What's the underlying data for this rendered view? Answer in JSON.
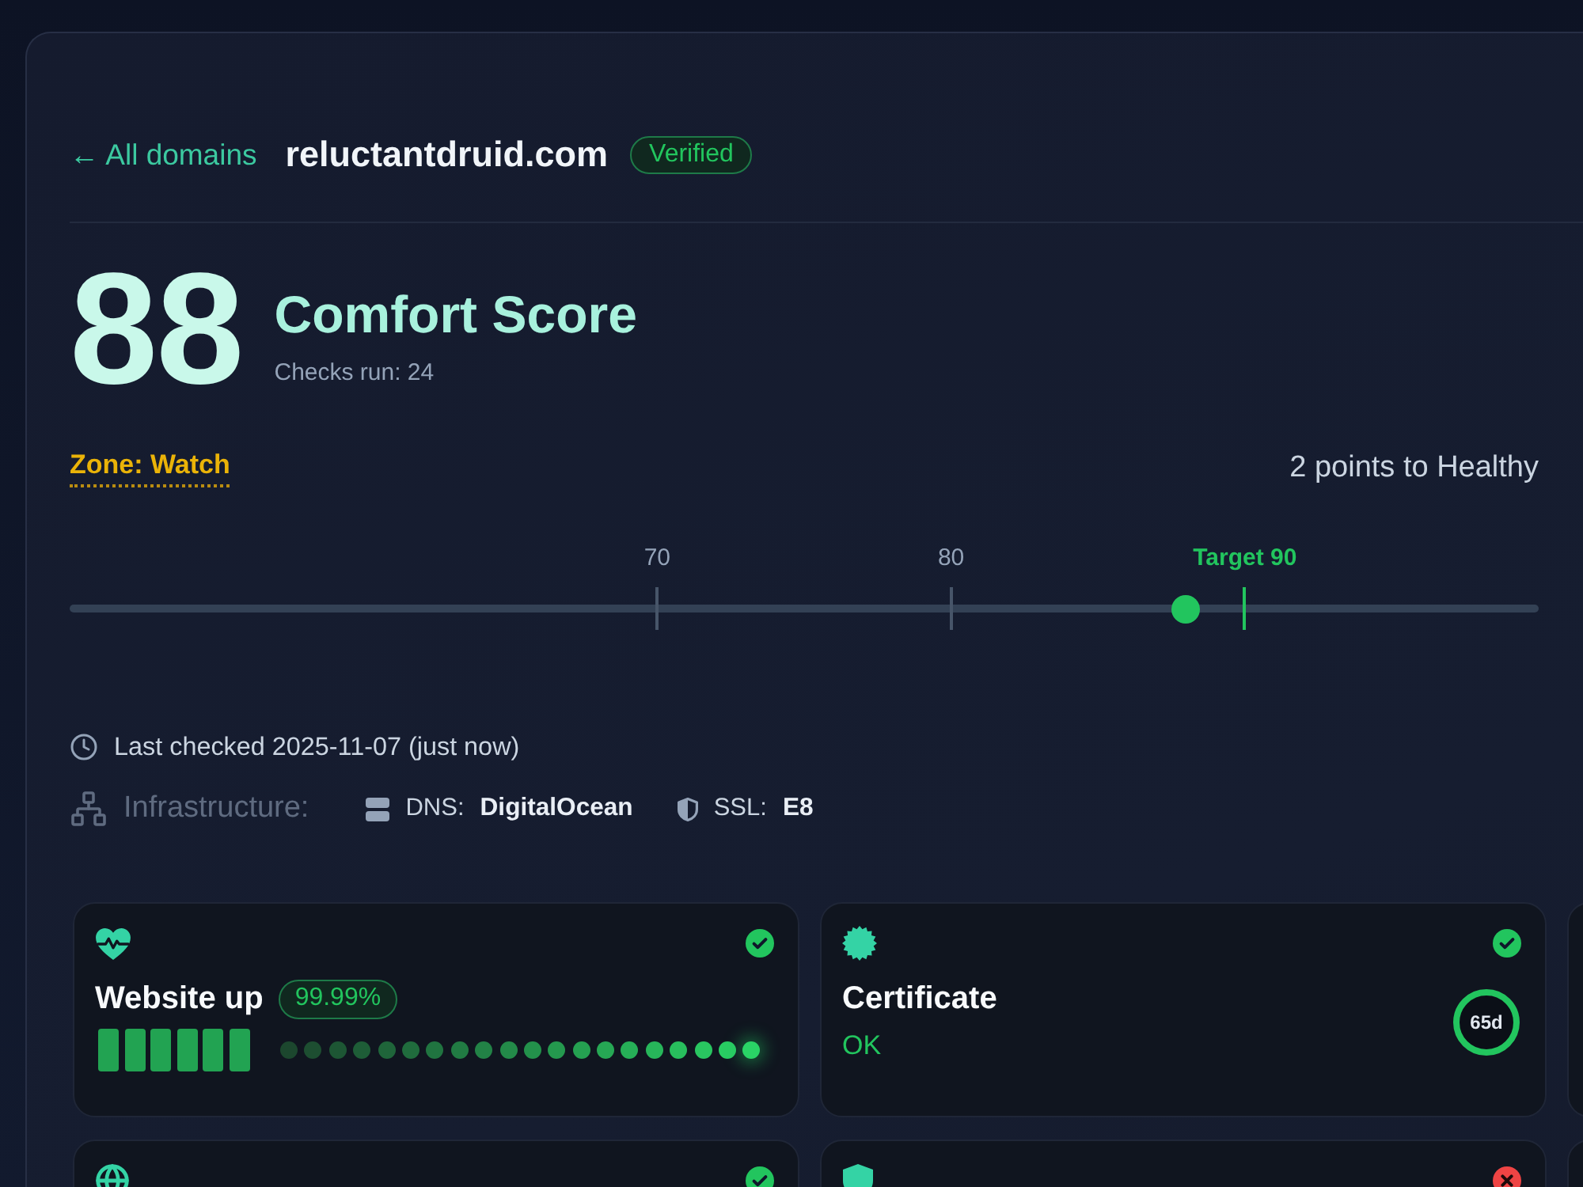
{
  "header": {
    "back_link": "← All domains",
    "domain": "reluctantdruid.com",
    "badge": "Verified"
  },
  "score": {
    "value": "88",
    "title": "Comfort Score",
    "subtitle": "Checks run: 24"
  },
  "zone": {
    "label": "Zone: Watch",
    "note": "2 points to Healthy"
  },
  "gauge": {
    "level": 0.76,
    "ticks": [
      {
        "kind": "mark",
        "label": "70",
        "level": 0.4
      },
      {
        "kind": "mark",
        "label": "80",
        "level": 0.6
      },
      {
        "kind": "target",
        "label": "Target 90",
        "level": 0.8
      }
    ]
  },
  "last_checked": "Last checked 2025-11-07 (just now)",
  "infrastructure": {
    "label": "Infrastructure:",
    "items": [
      {
        "kind": "dns",
        "key": "DNS:",
        "value": "DigitalOcean"
      },
      {
        "kind": "ssl",
        "key": "SSL:",
        "value": "E8"
      }
    ]
  },
  "cards": [
    {
      "kind": "uptime",
      "passed": true,
      "title": "Website up",
      "badge": "99.99%"
    },
    {
      "kind": "certificate",
      "passed": true,
      "title": "Certificate",
      "status": "OK",
      "ring_label": "65d"
    },
    {
      "kind": "blank"
    },
    {
      "kind": "globe",
      "passed": true
    },
    {
      "kind": "shield",
      "passed": false
    },
    {
      "kind": "blank"
    }
  ]
}
